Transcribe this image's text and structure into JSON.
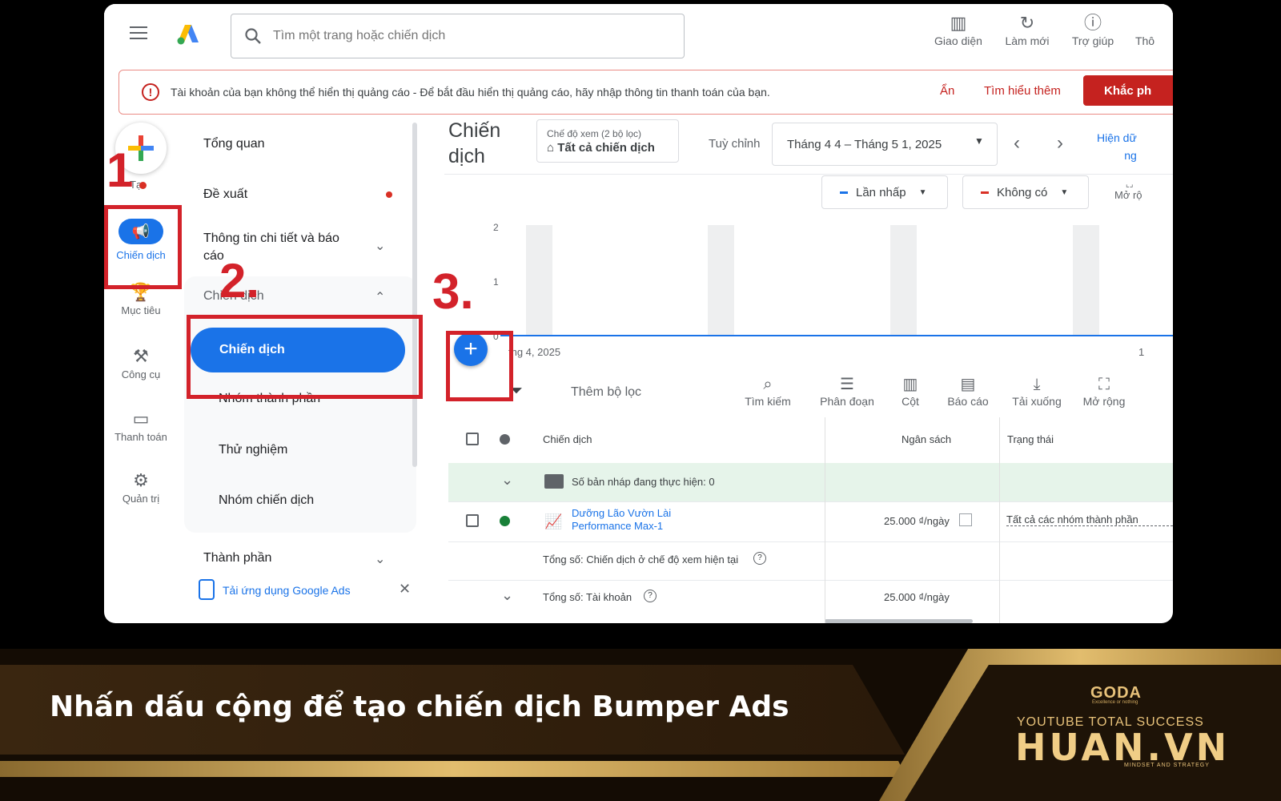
{
  "topbar": {
    "search_placeholder": "Tìm một trang hoặc chiến dịch",
    "items": [
      {
        "label": "Giao diện",
        "icon": "layout-icon"
      },
      {
        "label": "Làm mới",
        "icon": "refresh-icon"
      },
      {
        "label": "Trợ giúp",
        "icon": "help-icon"
      },
      {
        "label": "Thô",
        "icon": "notification-icon"
      }
    ]
  },
  "alert": {
    "message": "Tài khoản của bạn không thể hiển thị quảng cáo - Để bắt đầu hiển thị quảng cáo, hãy nhập thông tin thanh toán của bạn.",
    "hide": "Ẩn",
    "learn_more": "Tìm hiểu thêm",
    "fix": "Khắc ph"
  },
  "rail": {
    "create_label": "Tạ",
    "items": [
      {
        "label": "Chiến dịch",
        "icon": "megaphone-icon"
      },
      {
        "label": "Mục tiêu",
        "icon": "trophy-icon"
      },
      {
        "label": "Công cụ",
        "icon": "tools-icon"
      },
      {
        "label": "Thanh toán",
        "icon": "card-icon"
      },
      {
        "label": "Quản trị",
        "icon": "gear-icon"
      }
    ]
  },
  "nav": {
    "overview": "Tổng quan",
    "recommendations": "Đề xuất",
    "insights": "Thông tin chi tiết và báo cáo",
    "campaigns_section": "Chiến dịch",
    "campaigns": "Chiến dịch",
    "asset_groups": "Nhóm thành phần",
    "experiments": "Thử nghiệm",
    "campaign_groups": "Nhóm chiến dịch",
    "assets": "Thành phần",
    "get_app": "Tải ứng dụng Google Ads"
  },
  "steps": {
    "one": "1",
    "two": "2.",
    "three": "3."
  },
  "main": {
    "title": "Chiến dịch",
    "view_mode_label": "Chế độ xem (2 bộ lọc)",
    "view_mode_value": "Tất cả chiến dịch",
    "customize": "Tuỳ chỉnh",
    "date_range": "Tháng 4 4 – Tháng 5 1, 2025",
    "show_data": "Hiện dữ",
    "show_data_2": "ng",
    "metric1": "Lần nhấp",
    "metric2": "Không có",
    "expand_chart": "Mở rộ",
    "y_ticks": [
      "2",
      "1",
      "0"
    ],
    "x_start": "thg 4, 2025",
    "x_end": "1",
    "add_filter": "Thêm bộ lọc",
    "tools": [
      "Tìm kiếm",
      "Phân đoạn",
      "Cột",
      "Báo cáo",
      "Tải xuống",
      "Mở rộng"
    ],
    "columns": {
      "campaign": "Chiến dịch",
      "budget": "Ngân sách",
      "status": "Trạng thái"
    },
    "drafts": "Số bản nháp đang thực hiện: 0",
    "campaign_name_1": "Dưỡng Lão Vườn Lài",
    "campaign_name_2": "Performance Max-1",
    "campaign_budget": "25.000 ₫/ngày",
    "campaign_status": "Tất cả các nhóm thành phần",
    "total_view": "Tổng số: Chiến dịch ở chế độ xem hiện tại",
    "total_account": "Tổng số: Tài khoản",
    "total_account_budget": "25.000 ₫/ngày"
  },
  "banner": {
    "caption": "Nhấn dấu cộng để tạo chiến dịch Bumper Ads",
    "brand_small": "GODA",
    "brand_tagline": "Excellence or nothing",
    "subtitle": "YOUTUBE TOTAL SUCCESS",
    "brand": "HUAN.VN",
    "brand_sub": "MINDSET AND STRATEGY"
  },
  "colors": {
    "accent": "#1a73e8",
    "error": "#c5221f",
    "highlight": "#d3222a",
    "gold": "#d4a95c"
  }
}
